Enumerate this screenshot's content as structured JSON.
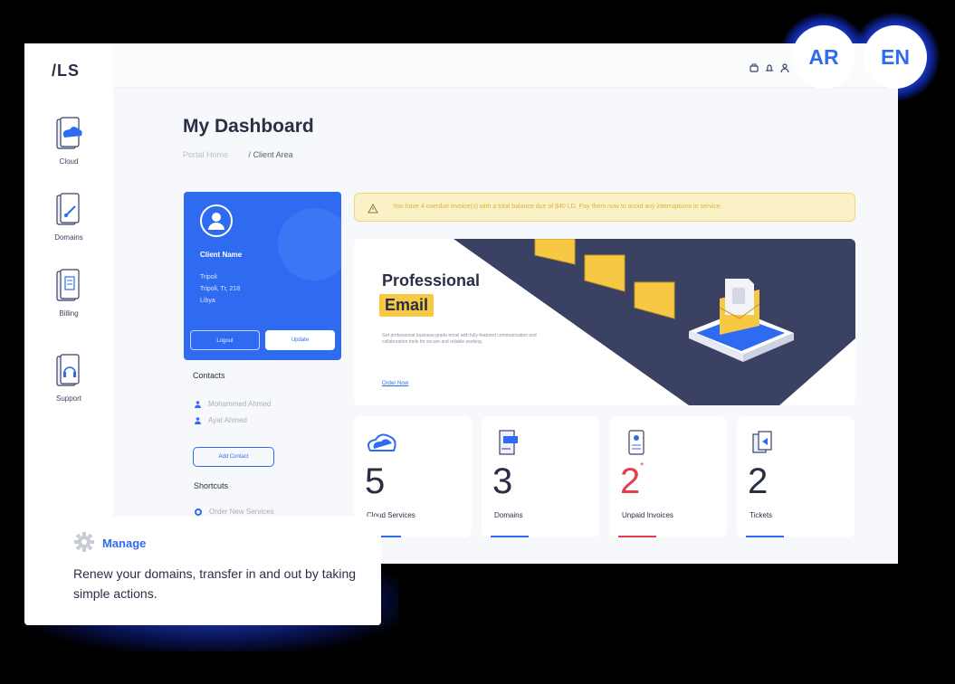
{
  "logo": "/LS",
  "sidebar": {
    "items": [
      {
        "label": "Cloud",
        "icon": "cloud-icon"
      },
      {
        "label": "Domains",
        "icon": "domains-icon"
      },
      {
        "label": "Billing",
        "icon": "billing-icon"
      },
      {
        "label": "Support",
        "icon": "support-icon"
      }
    ]
  },
  "topbar": {
    "icons": [
      "cart-icon",
      "bell-icon",
      "user-icon"
    ]
  },
  "languages": [
    "AR",
    "EN"
  ],
  "page": {
    "title": "My Dashboard",
    "breadcrumb": [
      "Portal Home",
      "Client Area"
    ]
  },
  "profile": {
    "name": "Client Name",
    "address": [
      "Tripoli",
      "Tripoli, Tr, 218",
      "Libya"
    ],
    "logout_label": "Logout",
    "update_label": "Update"
  },
  "contacts": {
    "title": "Contacts",
    "items": [
      "Mohammed Ahmed",
      "Ayat Ahmed"
    ],
    "add_label": "Add Contact"
  },
  "shortcuts": {
    "title": "Shortcuts",
    "items": [
      "Order New Services"
    ]
  },
  "alert": {
    "text": "You have 4 overdue invoice(s) with a total balance due of $40 LD. Pay them now to avoid any interruptions in service."
  },
  "banner": {
    "title_line1": "Professional",
    "title_line2": "Email",
    "description": "Get professional business-grade email with fully-featured communication and collaboration tools for secure and reliable working.",
    "cta": "Order Now"
  },
  "stats": [
    {
      "value": "5",
      "label": "Cloud Services",
      "color": "#2f6bf0",
      "icon": "cloud-icon"
    },
    {
      "value": "3",
      "label": "Domains",
      "color": "#2f6bf0",
      "icon": "domains-icon"
    },
    {
      "value": "2",
      "label": "Unpaid Invoices",
      "color": "#e53d4d",
      "icon": "invoice-icon",
      "marker": "*"
    },
    {
      "value": "2",
      "label": "Tickets",
      "color": "#2f6bf0",
      "icon": "tickets-icon"
    }
  ],
  "manage": {
    "title": "Manage",
    "text": "Renew your domains, transfer in and out by taking simple actions."
  },
  "colors": {
    "accent": "#2f6bf0",
    "dark": "#3a4163",
    "yellow": "#f6c844",
    "danger": "#e53d4d"
  }
}
